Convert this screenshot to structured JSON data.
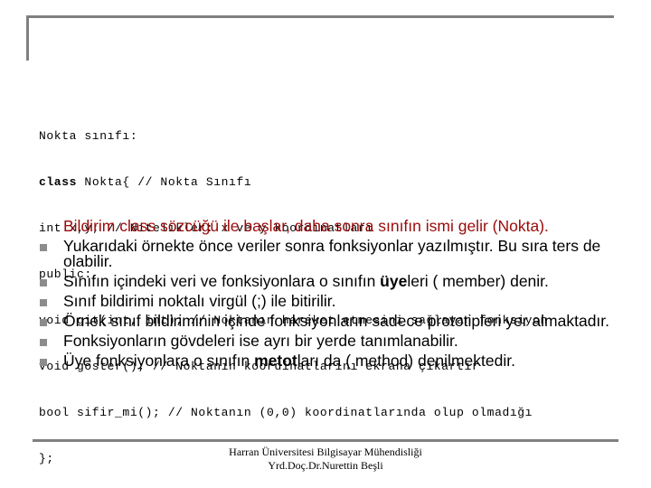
{
  "colors": {
    "frame": "#808080",
    "highlight_text": "#9b0a0a",
    "bullet": "#8c8c8c",
    "text": "#000000"
  },
  "code_block": {
    "lines": [
      {
        "kw": "",
        "text": "Nokta sınıfı:"
      },
      {
        "kw": "class",
        "text": " Nokta{ // Nokta Sınıfı"
      },
      {
        "kw": "",
        "text": "int x,y; // Nitelikler: x ve y koordinatları"
      },
      {
        "kw": "",
        "text": "public:"
      },
      {
        "kw": "",
        "text": "void git(int, int); // Noktanın hareket etmesini sağlayan fonksiyon"
      },
      {
        "kw": "",
        "text": "void goster(); // Noktanın koordinatlarını ekrana çıkartır"
      },
      {
        "kw": "",
        "text": "bool sifir_mi(); // Noktanın (0,0) koordinatlarında olup olmadığı"
      },
      {
        "kw": "",
        "text": "};"
      }
    ]
  },
  "bullets": [
    {
      "style": "red",
      "bullet_icon": "none",
      "parts": [
        {
          "bold": false,
          "text": "Bildirim class sözcüğü ile başlar, daha sonra sınıfın ismi gelir (Nokta)."
        }
      ]
    },
    {
      "style": "normal",
      "bullet_icon": "square-bullet",
      "parts": [
        {
          "bold": false,
          "text": "Yukarıdaki örnekte önce veriler sonra fonksiyonlar yazılmıştır. Bu sıra ters de olabilir."
        }
      ]
    },
    {
      "style": "normal",
      "bullet_icon": "square-bullet",
      "parts": [
        {
          "bold": false,
          "text": "Sınıfın içindeki veri ve fonksiyonlara o sınıfın "
        },
        {
          "bold": true,
          "text": "üye"
        },
        {
          "bold": false,
          "text": "leri ( member) denir."
        }
      ]
    },
    {
      "style": "normal",
      "bullet_icon": "square-bullet",
      "parts": [
        {
          "bold": false,
          "text": "Sınıf bildirimi noktalı virgül (;) ile bitirilir."
        }
      ]
    },
    {
      "style": "normal",
      "bullet_icon": "square-bullet",
      "parts": [
        {
          "bold": false,
          "text": "Örnek sınıf bildiriminin içinde fonksiyonların sadece prototipleri yer almaktadır."
        }
      ]
    },
    {
      "style": "normal",
      "bullet_icon": "square-bullet",
      "parts": [
        {
          "bold": false,
          "text": "Fonksiyonların gövdeleri ise ayrı bir yerde tanımlanabilir."
        }
      ]
    },
    {
      "style": "normal",
      "bullet_icon": "square-bullet",
      "parts": [
        {
          "bold": false,
          "text": "Üye fonksiyonlara o sınıfın "
        },
        {
          "bold": true,
          "text": "metot"
        },
        {
          "bold": false,
          "text": "ları da ( method) denilmektedir."
        }
      ]
    }
  ],
  "footer": {
    "line1": "Harran Üniversitesi Bilgisayar Mühendisliği",
    "line2": "Yrd.Doç.Dr.Nurettin Beşli"
  }
}
